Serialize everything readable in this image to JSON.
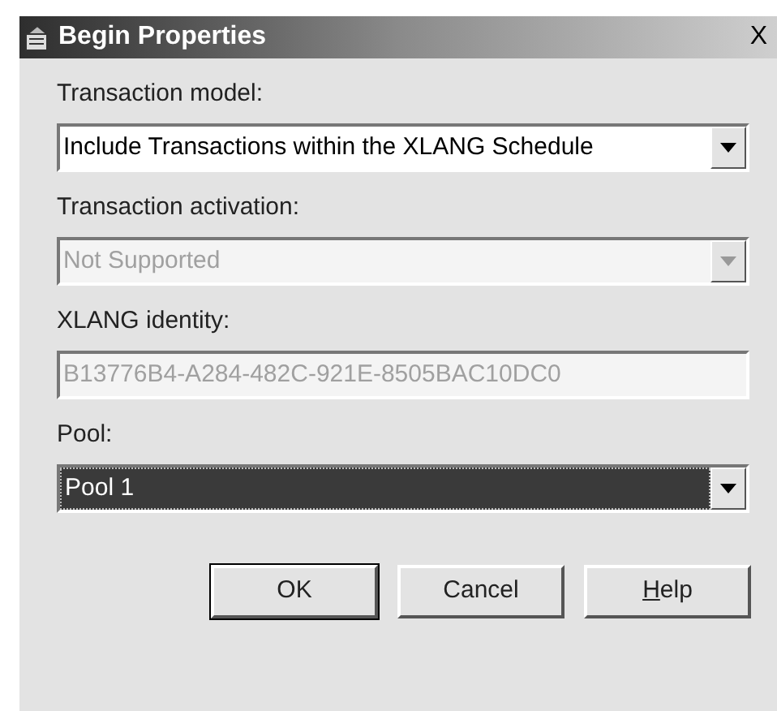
{
  "window": {
    "title": "Begin Properties",
    "close": "X"
  },
  "fields": [
    {
      "label": "Transaction model:",
      "kind": "dropdown",
      "value": "Include Transactions within the XLANG Schedule",
      "disabled": false,
      "focused": false
    },
    {
      "label": "Transaction activation:",
      "kind": "dropdown",
      "value": "Not Supported",
      "disabled": true,
      "focused": false
    },
    {
      "label": "XLANG identity:",
      "kind": "text",
      "value": "B13776B4-A284-482C-921E-8505BAC10DC0",
      "disabled": true,
      "focused": false
    },
    {
      "label": "Pool:",
      "kind": "dropdown",
      "value": "Pool 1",
      "disabled": false,
      "focused": true
    }
  ],
  "buttons": [
    {
      "label": "OK",
      "default": true,
      "mnemonic_underline": false
    },
    {
      "label": "Cancel",
      "default": false,
      "mnemonic_underline": false
    },
    {
      "label": "Help",
      "default": false,
      "mnemonic_underline": true
    }
  ]
}
